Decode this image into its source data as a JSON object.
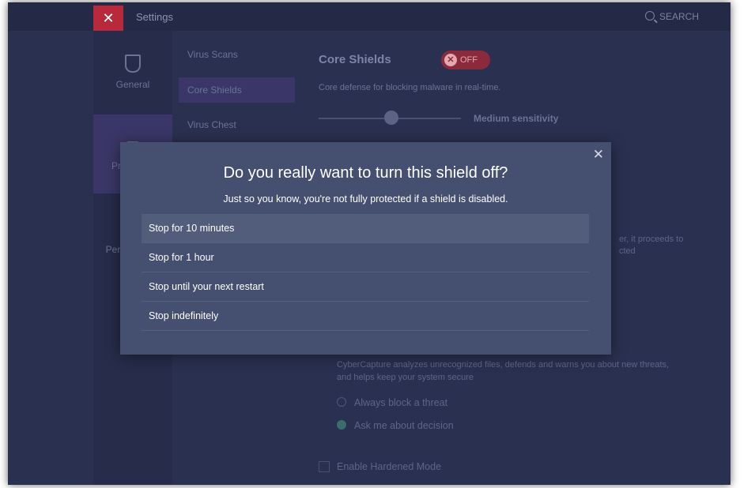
{
  "app": {
    "title": "Settings",
    "logo_glyph": "✕",
    "search_label": "SEARCH"
  },
  "nav": {
    "items": [
      {
        "label": "General"
      },
      {
        "label": "Protection"
      },
      {
        "label": "Performance"
      }
    ]
  },
  "subnav": {
    "items": [
      {
        "label": "Virus Scans"
      },
      {
        "label": "Core Shields"
      },
      {
        "label": "Virus Chest"
      }
    ]
  },
  "content": {
    "section_title": "Core Shields",
    "toggle_label": "OFF",
    "toggle_glyph": "✕",
    "description": "Core defense for blocking malware in real-time.",
    "sensitivity_label": "Medium sensitivity",
    "partial_text_1": "er, it proceeds to",
    "partial_text_2": "cted",
    "cybercapture_desc_1": "CyberCapture analyzes unrecognized files, defends and warns you about new threats,",
    "cybercapture_desc_2": "and helps keep your system secure",
    "radio_options": [
      {
        "label": "Always block a threat",
        "checked": false
      },
      {
        "label": "Ask me about decision",
        "checked": true
      }
    ],
    "hardened_label": "Enable Hardened Mode"
  },
  "dialog": {
    "close_glyph": "✕",
    "title": "Do you really want to turn this shield off?",
    "subtitle": "Just so you know, you're not fully protected if a shield is disabled.",
    "options": [
      {
        "label": "Stop for 10 minutes"
      },
      {
        "label": "Stop for 1 hour"
      },
      {
        "label": "Stop until your next restart"
      },
      {
        "label": "Stop indefinitely"
      }
    ]
  },
  "colors": {
    "background": "#2a3050",
    "dialog": "#454f6f",
    "option_hover": "#525d7c",
    "toggle_off": "#8b2a3d"
  }
}
